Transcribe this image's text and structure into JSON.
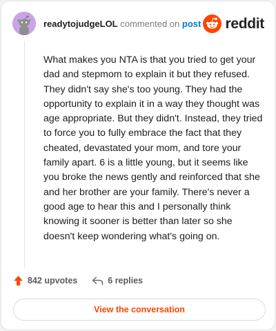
{
  "header": {
    "username": "readytojudgeLOL",
    "action_text": "commented on",
    "post_link": "post"
  },
  "brand": {
    "wordmark": "reddit",
    "icon": "reddit-snoo-icon",
    "color": "#ff4500"
  },
  "comment": {
    "text": "What makes you NTA is that you tried to get your dad and stepmom to explain it but they refused. They didn't say she's too young. They had the opportunity to explain it in a way they thought was age appropriate. But they didn't. Instead, they tried to force you to fully embrace the fact that they cheated, devastated your mom, and tore your family apart. 6 is a little young, but it seems like you broke the news gently and reinforced that she and her brother are your family. There's never a good age to hear this and I personally think knowing it sooner is better than later so she doesn't keep wondering what's going on."
  },
  "actions": {
    "upvotes_label": "842 upvotes",
    "upvote_icon": "upvote-arrow-icon",
    "replies_label": "6 replies",
    "reply_icon": "reply-arrow-icon"
  },
  "cta": {
    "label": "View the conversation"
  },
  "colors": {
    "accent": "#ff4500",
    "link": "#0079d3",
    "avatar_bg": "#c9a5e6"
  }
}
